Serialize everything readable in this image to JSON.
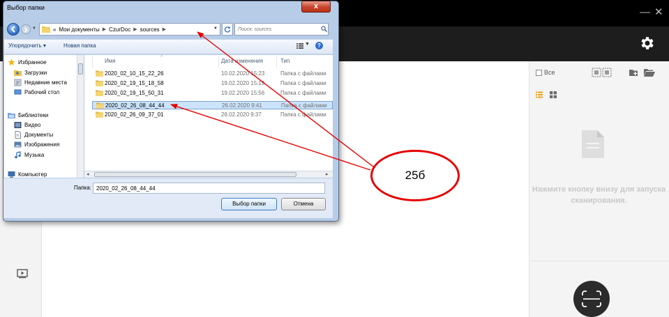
{
  "window_controls": {
    "minimize": "—",
    "close": "✕"
  },
  "right_panel": {
    "select_all_label": "Все",
    "hint": "Нажмите кнопку внизу для запуска сканирования."
  },
  "dialog": {
    "title": "Выбор папки",
    "close_glyph": "x",
    "address": [
      "«",
      "Мои документы",
      "CzurDoc",
      "sources"
    ],
    "search_placeholder": "Поиск: sources",
    "toolbar": {
      "organize": "Упорядочить ▾",
      "new_folder": "Новая папка"
    },
    "nav": {
      "favorites": "Избранное",
      "downloads": "Загрузки",
      "recent": "Недавние места",
      "desktop": "Рабочий стол",
      "libraries": "Библиотеки",
      "video": "Видео",
      "documents": "Документы",
      "images": "Изображения",
      "music": "Музыка",
      "computer": "Компьютер"
    },
    "columns": {
      "name": "Имя",
      "date": "Дата изменения",
      "type": "Тип"
    },
    "rows": [
      {
        "name": "2020_02_10_15_22_26",
        "date": "10.02.2020 15:23",
        "type": "Папка с файлами"
      },
      {
        "name": "2020_02_19_15_18_58",
        "date": "19.02.2020 15:19",
        "type": "Папка с файлами"
      },
      {
        "name": "2020_02_19_15_50_31",
        "date": "19.02.2020 15:56",
        "type": "Папка с файлами"
      },
      {
        "name": "2020_02_26_08_44_44",
        "date": "26.02.2020 9:41",
        "type": "Папка с файлами"
      },
      {
        "name": "2020_02_26_09_37_01",
        "date": "26.02.2020 9:37",
        "type": "Папка с файлами"
      }
    ],
    "selected_row": 3,
    "folder_label": "Папка:",
    "folder_value": "2020_02_26_08_44_44",
    "select_button": "Выбор папки",
    "cancel_button": "Отмена"
  },
  "annotation": {
    "label": "25б",
    "color": "#e60000"
  },
  "colors": {
    "app_header": "#1d1d1d",
    "titlebar": "#000000",
    "dialog_frame": "#b7cde7",
    "selection": "#cce4fb"
  }
}
